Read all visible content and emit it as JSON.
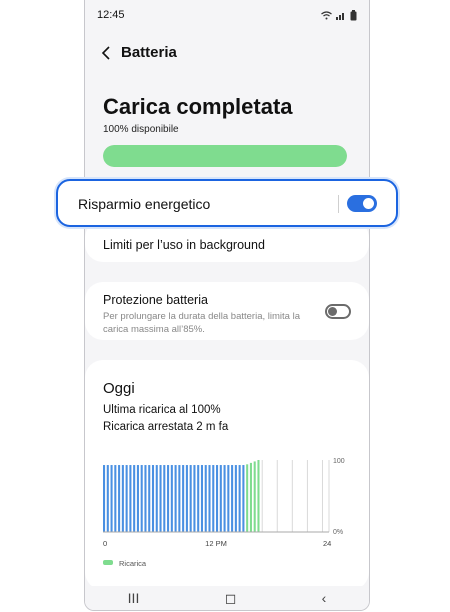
{
  "status_bar": {
    "time": "12:45"
  },
  "header": {
    "title": "Batteria"
  },
  "battery": {
    "status_title": "Carica completata",
    "available_text": "100% disponibile",
    "level_fraction": 1.0,
    "bar_color": "#7fdc8f"
  },
  "power_saving": {
    "label": "Risparmio energetico",
    "enabled": true,
    "accent": "#2a6fe0"
  },
  "background_limits": {
    "label": "Limiti per l’uso in background"
  },
  "protection": {
    "title": "Protezione batteria",
    "description": "Per prolungare la durata della batteria, limita la carica massima all’85%.",
    "enabled": false
  },
  "today": {
    "title": "Oggi",
    "last_charge": "Ultima ricarica al 100%",
    "charge_stopped": "Ricarica arrestata 2 m fa"
  },
  "chart_data": {
    "type": "bar",
    "x_ticks": [
      "0",
      "12 PM",
      "24"
    ],
    "y_ticks": [
      "100",
      "0%"
    ],
    "ylim": [
      0,
      100
    ],
    "series": [
      {
        "name": "Ricarica",
        "color": "#7fdc8f"
      }
    ],
    "bars": [
      {
        "v": 93,
        "c": "#4a90e2"
      },
      {
        "v": 93,
        "c": "#4a90e2"
      },
      {
        "v": 93,
        "c": "#4a90e2"
      },
      {
        "v": 93,
        "c": "#4a90e2"
      },
      {
        "v": 93,
        "c": "#4a90e2"
      },
      {
        "v": 93,
        "c": "#4a90e2"
      },
      {
        "v": 93,
        "c": "#4a90e2"
      },
      {
        "v": 93,
        "c": "#4a90e2"
      },
      {
        "v": 93,
        "c": "#4a90e2"
      },
      {
        "v": 93,
        "c": "#4a90e2"
      },
      {
        "v": 93,
        "c": "#4a90e2"
      },
      {
        "v": 93,
        "c": "#4a90e2"
      },
      {
        "v": 93,
        "c": "#4a90e2"
      },
      {
        "v": 93,
        "c": "#4a90e2"
      },
      {
        "v": 93,
        "c": "#4a90e2"
      },
      {
        "v": 93,
        "c": "#4a90e2"
      },
      {
        "v": 93,
        "c": "#4a90e2"
      },
      {
        "v": 93,
        "c": "#4a90e2"
      },
      {
        "v": 93,
        "c": "#4a90e2"
      },
      {
        "v": 93,
        "c": "#4a90e2"
      },
      {
        "v": 93,
        "c": "#4a90e2"
      },
      {
        "v": 93,
        "c": "#4a90e2"
      },
      {
        "v": 93,
        "c": "#4a90e2"
      },
      {
        "v": 93,
        "c": "#4a90e2"
      },
      {
        "v": 93,
        "c": "#4a90e2"
      },
      {
        "v": 93,
        "c": "#4a90e2"
      },
      {
        "v": 93,
        "c": "#4a90e2"
      },
      {
        "v": 93,
        "c": "#4a90e2"
      },
      {
        "v": 93,
        "c": "#4a90e2"
      },
      {
        "v": 93,
        "c": "#4a90e2"
      },
      {
        "v": 93,
        "c": "#4a90e2"
      },
      {
        "v": 93,
        "c": "#4a90e2"
      },
      {
        "v": 93,
        "c": "#4a90e2"
      },
      {
        "v": 93,
        "c": "#4a90e2"
      },
      {
        "v": 93,
        "c": "#4a90e2"
      },
      {
        "v": 93,
        "c": "#4a90e2"
      },
      {
        "v": 93,
        "c": "#4a90e2"
      },
      {
        "v": 93,
        "c": "#4a90e2"
      },
      {
        "v": 94,
        "c": "#7fdc8f"
      },
      {
        "v": 96,
        "c": "#7fdc8f"
      },
      {
        "v": 98,
        "c": "#7fdc8f"
      },
      {
        "v": 100,
        "c": "#7fdc8f"
      }
    ]
  },
  "legend": [
    {
      "label": "Ricarica",
      "color": "#7fdc8f"
    }
  ],
  "nav_bar": {
    "recents_icon": "III",
    "home_icon": "◻",
    "back_icon": "‹"
  }
}
